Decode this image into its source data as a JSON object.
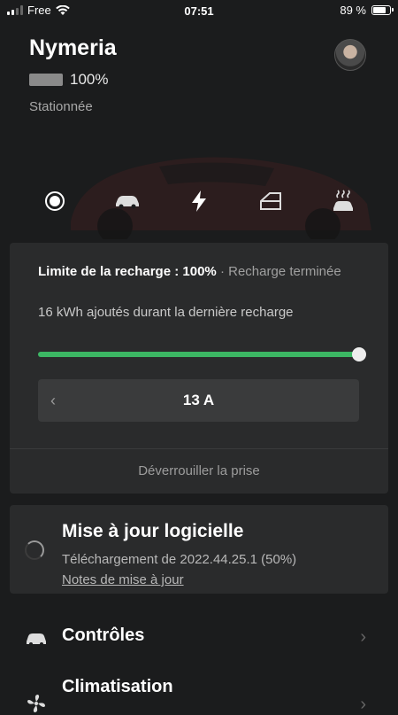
{
  "status_bar": {
    "carrier": "Free",
    "time": "07:51",
    "battery_pct": "89 %",
    "battery_level": 0.89
  },
  "vehicle": {
    "name": "Nymeria",
    "battery_pct": "100%",
    "battery_level": 1.0,
    "state": "Stationnée"
  },
  "nav": {
    "icons": [
      "record-icon",
      "car-icon",
      "bolt-icon",
      "door-icon",
      "heated-car-icon"
    ],
    "active": "bolt-icon"
  },
  "charge": {
    "limit_label": "Limite de la recharge : 100%",
    "separator": "·",
    "status": "Recharge terminée",
    "added": "16 kWh ajoutés durant la dernière recharge",
    "limit_fraction": 1.0,
    "accent": "#3cb764",
    "amps_prev": "‹",
    "amps": "13 A",
    "unlock": "Déverrouiller la prise"
  },
  "update": {
    "title": "Mise à jour logicielle",
    "status": "Téléchargement de 2022.44.25.1 (50%)",
    "notes_link": "Notes de mise à jour"
  },
  "menu": {
    "controls": "Contrôles",
    "climate": "Climatisation",
    "chevron": "›"
  }
}
